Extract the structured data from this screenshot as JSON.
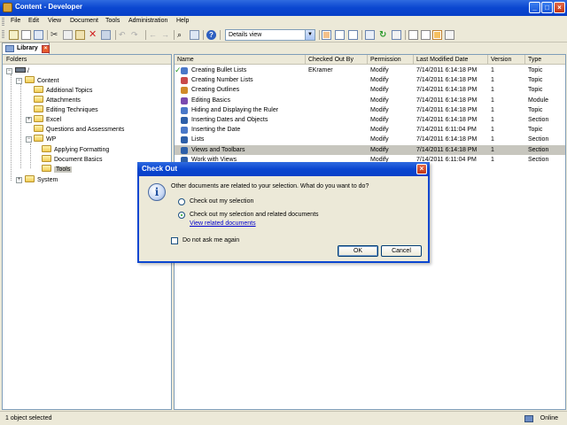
{
  "window": {
    "title": "Content - Developer"
  },
  "menu": [
    "File",
    "Edit",
    "View",
    "Document",
    "Tools",
    "Administration",
    "Help"
  ],
  "toolbar": {
    "view_select": "Details view"
  },
  "tab": {
    "label": "Library"
  },
  "folders": {
    "header": "Folders",
    "items": [
      {
        "label": "/",
        "level": 0
      },
      {
        "label": "Content",
        "level": 1
      },
      {
        "label": "Additional Topics",
        "level": 2
      },
      {
        "label": "Attachments",
        "level": 2
      },
      {
        "label": "Editing Techniques",
        "level": 2
      },
      {
        "label": "Excel",
        "level": 2
      },
      {
        "label": "Questions and Assessments",
        "level": 2
      },
      {
        "label": "WP",
        "level": 2
      },
      {
        "label": "Applying Formatting",
        "level": 3
      },
      {
        "label": "Document Basics",
        "level": 3
      },
      {
        "label": "Tools",
        "level": 3
      },
      {
        "label": "System",
        "level": 1
      }
    ]
  },
  "documents": {
    "columns": [
      "Name",
      "Checked Out By",
      "Permission",
      "Last Modified Date",
      "Version",
      "Type"
    ],
    "rows": [
      {
        "name": "Creating Bullet Lists",
        "checked_out_by": "EKramer",
        "permission": "Modify",
        "modified": "7/14/2011 6:14:18 PM",
        "version": "1",
        "type": "Topic"
      },
      {
        "name": "Creating Number Lists",
        "checked_out_by": "",
        "permission": "Modify",
        "modified": "7/14/2011 6:14:18 PM",
        "version": "1",
        "type": "Topic"
      },
      {
        "name": "Creating Outlines",
        "checked_out_by": "",
        "permission": "Modify",
        "modified": "7/14/2011 6:14:18 PM",
        "version": "1",
        "type": "Topic"
      },
      {
        "name": "Editing Basics",
        "checked_out_by": "",
        "permission": "Modify",
        "modified": "7/14/2011 6:14:18 PM",
        "version": "1",
        "type": "Module"
      },
      {
        "name": "Hiding and Displaying the Ruler",
        "checked_out_by": "",
        "permission": "Modify",
        "modified": "7/14/2011 6:14:18 PM",
        "version": "1",
        "type": "Topic"
      },
      {
        "name": "Inserting Dates and Objects",
        "checked_out_by": "",
        "permission": "Modify",
        "modified": "7/14/2011 6:14:18 PM",
        "version": "1",
        "type": "Section"
      },
      {
        "name": "Inserting the Date",
        "checked_out_by": "",
        "permission": "Modify",
        "modified": "7/14/2011 6:11:04 PM",
        "version": "1",
        "type": "Topic"
      },
      {
        "name": "Lists",
        "checked_out_by": "",
        "permission": "Modify",
        "modified": "7/14/2011 6:14:18 PM",
        "version": "1",
        "type": "Section"
      },
      {
        "name": "Views and Toolbars",
        "checked_out_by": "",
        "permission": "Modify",
        "modified": "7/14/2011 6:14:18 PM",
        "version": "1",
        "type": "Section"
      },
      {
        "name": "Work with Views",
        "checked_out_by": "",
        "permission": "Modify",
        "modified": "7/14/2011 6:11:04 PM",
        "version": "1",
        "type": "Section"
      }
    ]
  },
  "status": {
    "text": "1 object selected",
    "online": "Online"
  },
  "dialog": {
    "title": "Check Out",
    "question": "Other documents are related to your selection. What do you want to do?",
    "option1": "Check out my selection",
    "option2": "Check out my selection and related documents",
    "link": "View related documents",
    "checkbox": "Do not ask me again",
    "ok": "OK",
    "cancel": "Cancel"
  }
}
